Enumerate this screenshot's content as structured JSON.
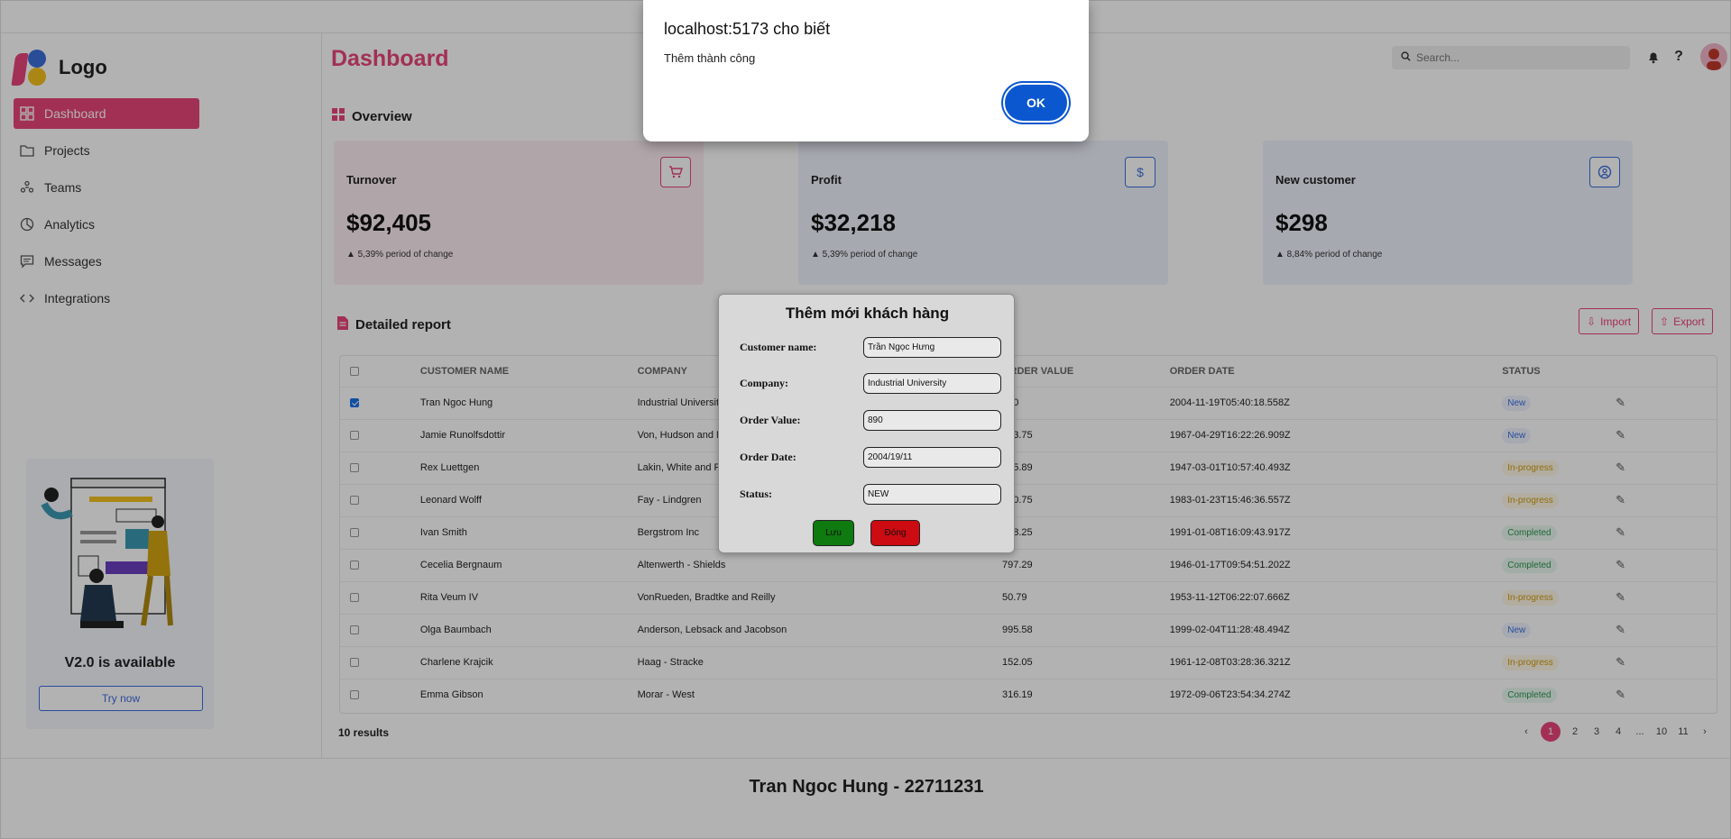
{
  "sidebar": {
    "logo_text": "Logo",
    "items": [
      {
        "label": "Dashboard",
        "icon": "grid-icon",
        "active": true
      },
      {
        "label": "Projects",
        "icon": "folder-icon"
      },
      {
        "label": "Teams",
        "icon": "team-icon"
      },
      {
        "label": "Analytics",
        "icon": "pie-chart-icon"
      },
      {
        "label": "Messages",
        "icon": "message-icon"
      },
      {
        "label": "Integrations",
        "icon": "code-icon"
      }
    ],
    "promo": {
      "title": "V2.0 is available",
      "button": "Try now"
    }
  },
  "header": {
    "title": "Dashboard",
    "search_placeholder": "Search..."
  },
  "overview": {
    "title": "Overview",
    "cards": [
      {
        "title": "Turnover",
        "value": "$92,405",
        "change": "▲ 5,39% period of change",
        "icon": "cart-icon",
        "accent": "#e8457a",
        "bg": "#fdeef3"
      },
      {
        "title": "Profit",
        "value": "$32,218",
        "change": "▲ 5,39% period of change",
        "icon": "dollar-icon",
        "accent": "#3d6fdc",
        "bg": "#eef3fd"
      },
      {
        "title": "New customer",
        "value": "$298",
        "change": "▲ 8,84% period of change",
        "icon": "user-circle-icon",
        "accent": "#3d6fdc",
        "bg": "#eef3fd"
      }
    ]
  },
  "report": {
    "title": "Detailed report",
    "import_label": "Import",
    "export_label": "Export",
    "columns": [
      "CUSTOMER NAME",
      "COMPANY",
      "ORDER VALUE",
      "ORDER DATE",
      "STATUS"
    ],
    "rows": [
      {
        "checked": true,
        "name": "Tran Ngoc Hung",
        "company": "Industrial University",
        "value": "890",
        "date": "2004-11-19T05:40:18.558Z",
        "status": "New"
      },
      {
        "checked": false,
        "name": "Jamie Runolfsdottir",
        "company": "Von, Hudson and Mayert",
        "value": "263.75",
        "date": "1967-04-29T16:22:26.909Z",
        "status": "New"
      },
      {
        "checked": false,
        "name": "Rex Luettgen",
        "company": "Lakin, White and Runte",
        "value": "445.89",
        "date": "1947-03-01T10:57:40.493Z",
        "status": "In-progress"
      },
      {
        "checked": false,
        "name": "Leonard Wolff",
        "company": "Fay - Lindgren",
        "value": "130.75",
        "date": "1983-01-23T15:46:36.557Z",
        "status": "In-progress"
      },
      {
        "checked": false,
        "name": "Ivan Smith",
        "company": "Bergstrom Inc",
        "value": "668.25",
        "date": "1991-01-08T16:09:43.917Z",
        "status": "Completed"
      },
      {
        "checked": false,
        "name": "Cecelia Bergnaum",
        "company": "Altenwerth - Shields",
        "value": "797.29",
        "date": "1946-01-17T09:54:51.202Z",
        "status": "Completed"
      },
      {
        "checked": false,
        "name": "Rita Veum IV",
        "company": "VonRueden, Bradtke and Reilly",
        "value": "50.79",
        "date": "1953-11-12T06:22:07.666Z",
        "status": "In-progress"
      },
      {
        "checked": false,
        "name": "Olga Baumbach",
        "company": "Anderson, Lebsack and Jacobson",
        "value": "995.58",
        "date": "1999-02-04T11:28:48.494Z",
        "status": "New"
      },
      {
        "checked": false,
        "name": "Charlene Krajcik",
        "company": "Haag - Stracke",
        "value": "152.05",
        "date": "1961-12-08T03:28:36.321Z",
        "status": "In-progress"
      },
      {
        "checked": false,
        "name": "Emma Gibson",
        "company": "Morar - West",
        "value": "316.19",
        "date": "1972-09-06T23:54:34.274Z",
        "status": "Completed"
      }
    ],
    "results": "10 results",
    "pages": [
      "‹",
      "1",
      "2",
      "3",
      "4",
      "...",
      "10",
      "11",
      "›"
    ],
    "current_page": "1"
  },
  "footer": {
    "text": "Tran Ngoc Hung - 22711231"
  },
  "modal": {
    "title": "Thêm mới khách hàng",
    "fields": [
      {
        "label": "Customer name:",
        "value": "Trần Ngọc Hưng"
      },
      {
        "label": "Company:",
        "value": "Industrial University"
      },
      {
        "label": "Order Value:",
        "value": "890"
      },
      {
        "label": "Order Date:",
        "value": "2004/19/11"
      },
      {
        "label": "Status:",
        "value": "NEW"
      }
    ],
    "save_label": "Lưu",
    "close_label": "Đóng"
  },
  "alert": {
    "origin": "localhost:5173 cho biết",
    "message": "Thêm thành công",
    "ok_label": "OK"
  }
}
